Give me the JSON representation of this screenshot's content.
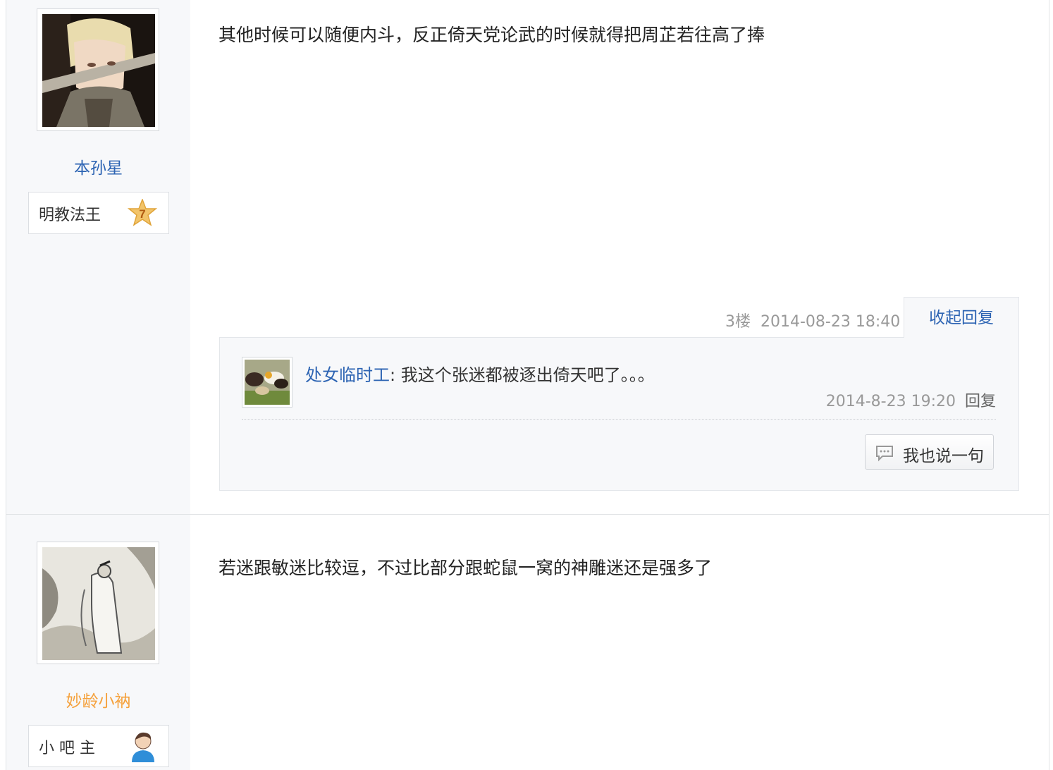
{
  "posts": [
    {
      "author": "本孙星",
      "level_title": "明教法王",
      "level_num": "7",
      "content": "其他时候可以随便内斗，反正倚天党论武的时候就得把周芷若往高了捧",
      "floor": "3楼",
      "time": "2014-08-23 18:40",
      "collapse_label": "收起回复",
      "replies": [
        {
          "user": "处女临时工",
          "text": ": 我这个张迷都被逐出倚天吧了。。。",
          "time": "2014-8-23 19:20",
          "reply_label": "回复"
        }
      ],
      "say_label": "我也说一句"
    },
    {
      "author": "妙龄小衲",
      "level_title": "小 吧 主",
      "content": "若迷跟敏迷比较逗，不过比部分跟蛇鼠一窝的神雕迷还是强多了"
    }
  ],
  "colors": {
    "link_blue": "#2d64b3",
    "moderator_orange": "#f5a13c",
    "meta_gray": "#999999",
    "author_bg": "#f7f8fa"
  },
  "icons": {
    "level_badge": "star-badge-icon",
    "moderator": "user-icon",
    "comment": "comment-icon"
  }
}
